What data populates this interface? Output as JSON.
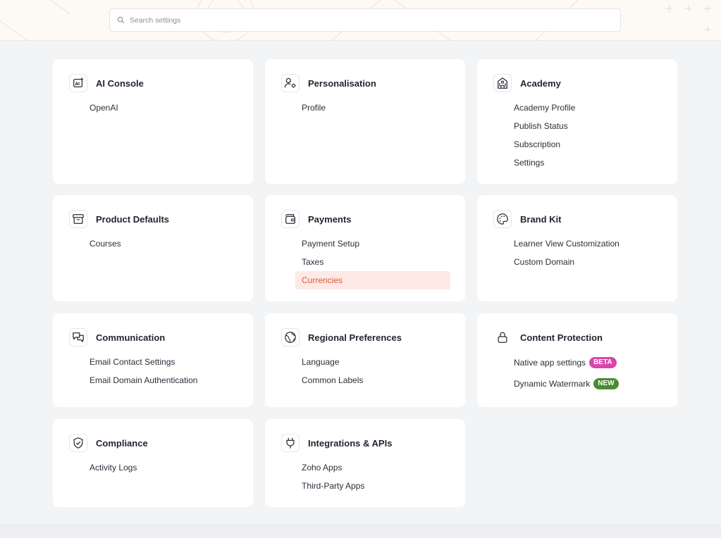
{
  "search": {
    "placeholder": "Search settings"
  },
  "colors": {
    "accent": "#e0553b",
    "accent_bg": "#fdeae6",
    "beta": "#d946a8",
    "new": "#4b8b2f"
  },
  "cards": [
    {
      "title": "AI Console",
      "icon": "ai-sparkle-icon",
      "links": [
        "OpenAI"
      ]
    },
    {
      "title": "Personalisation",
      "icon": "user-gear-icon",
      "links": [
        "Profile"
      ]
    },
    {
      "title": "Academy",
      "icon": "building-icon",
      "links": [
        "Academy Profile",
        "Publish Status",
        "Subscription",
        "Settings"
      ]
    },
    {
      "title": "Product Defaults",
      "icon": "archive-box-icon",
      "links": [
        "Courses"
      ]
    },
    {
      "title": "Payments",
      "icon": "wallet-icon",
      "links": [
        "Payment Setup",
        "Taxes",
        "Currencies"
      ],
      "active_link": "Currencies"
    },
    {
      "title": "Brand Kit",
      "icon": "palette-icon",
      "links": [
        "Learner View Customization",
        "Custom Domain"
      ]
    },
    {
      "title": "Communication",
      "icon": "chat-bubbles-icon",
      "links": [
        "Email Contact Settings",
        "Email Domain Authentication"
      ]
    },
    {
      "title": "Regional Preferences",
      "icon": "globe-icon",
      "links": [
        "Language",
        "Common Labels"
      ]
    },
    {
      "title": "Content Protection",
      "icon": "lock-icon",
      "links": [
        "Native app settings",
        "Dynamic Watermark"
      ],
      "badges": [
        "BETA",
        "NEW"
      ]
    },
    {
      "title": "Compliance",
      "icon": "shield-check-icon",
      "links": [
        "Activity Logs"
      ]
    },
    {
      "title": "Integrations & APIs",
      "icon": "plug-icon",
      "links": [
        "Zoho Apps",
        "Third-Party Apps"
      ]
    }
  ]
}
